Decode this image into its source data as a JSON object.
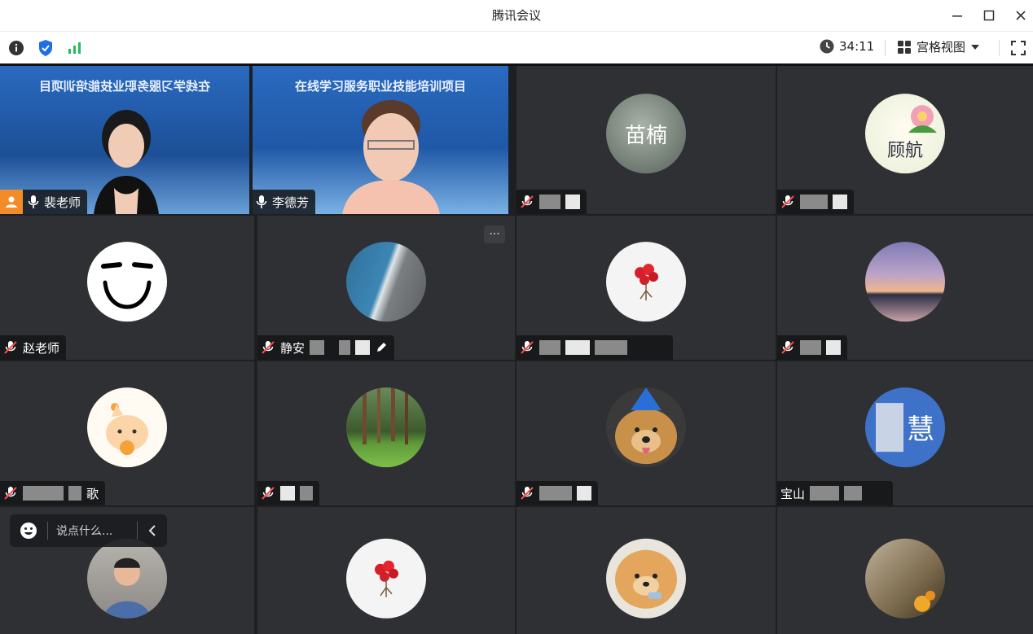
{
  "window": {
    "title": "腾讯会议"
  },
  "toolbar": {
    "timer": "34:11",
    "view_label": "宫格视图"
  },
  "colors": {
    "accent": "#1e6ee6",
    "signal": "#1fbf5b",
    "dark_tile": "#2e3034"
  },
  "tiles": [
    {
      "banner": "在线学习服务职业技能培训项目",
      "name": "裴老师"
    },
    {
      "banner": "在线学习服务职业技能培训项目",
      "name": "李德芳"
    },
    {
      "avatar_text": "苗楠",
      "name": ""
    },
    {
      "avatar_text": "顾航",
      "name": ""
    },
    {
      "name": "赵老师"
    },
    {
      "name": "静安"
    },
    {
      "name": ""
    },
    {
      "name": ""
    },
    {
      "name": "歌"
    },
    {
      "name": ""
    },
    {
      "name": ""
    },
    {
      "avatar_text": "慧",
      "name": "宝山"
    },
    {
      "name": ""
    },
    {
      "name": ""
    },
    {
      "name": ""
    },
    {
      "name": ""
    }
  ],
  "chat": {
    "placeholder": "说点什么..."
  }
}
